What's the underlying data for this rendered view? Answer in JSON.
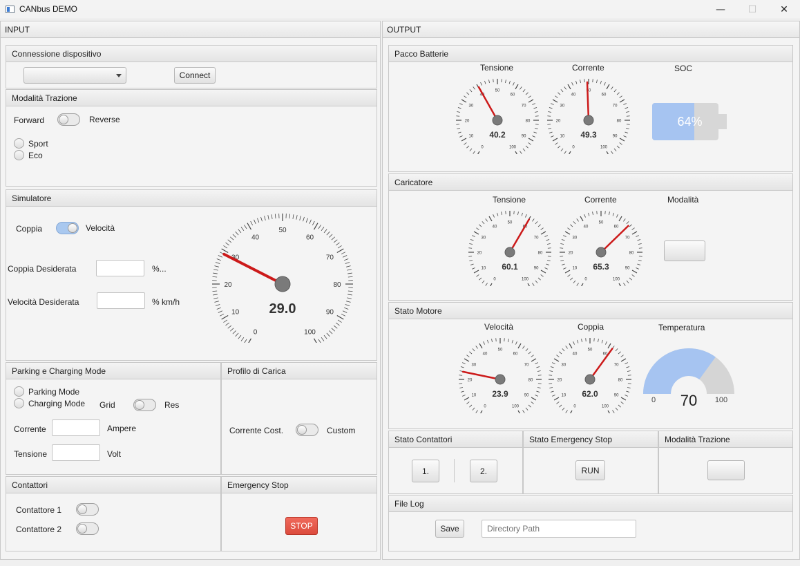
{
  "window": {
    "title": "CANbus DEMO",
    "minimize": "—",
    "maximize": "☐",
    "close": "✕"
  },
  "input": {
    "header": "INPUT",
    "connessione": {
      "title": "Connessione dispositivo",
      "connect_label": "Connect",
      "combo_value": ""
    },
    "modalita": {
      "title": "Modalità Trazione",
      "forward": "Forward",
      "reverse": "Reverse",
      "sport": "Sport",
      "eco": "Eco"
    },
    "simulatore": {
      "title": "Simulatore",
      "coppia": "Coppia",
      "velocita": "Velocità",
      "coppia_desiderata": "Coppia Desiderata",
      "coppia_unit": "%...",
      "velocita_desiderata": "Velocità Desiderata",
      "velocita_unit": "% km/h",
      "gauge": {
        "value": 29.0,
        "display": "29.0",
        "min": 0,
        "max": 100,
        "labels": [
          "0",
          "10",
          "20",
          "30",
          "40",
          "50",
          "60",
          "70",
          "80",
          "90",
          "100"
        ]
      }
    },
    "parking": {
      "title": "Parking e Charging Mode",
      "parking_mode": "Parking Mode",
      "charging_mode": "Charging Mode",
      "grid": "Grid",
      "res": "Res",
      "corrente": "Corrente",
      "ampere": "Ampere",
      "tensione": "Tensione",
      "volt": "Volt"
    },
    "profilo": {
      "title": "Profilo di Carica",
      "corrente_cost": "Corrente Cost.",
      "custom": "Custom"
    },
    "contattori": {
      "title": "Contattori",
      "c1": "Contattore 1",
      "c2": "Contattore 2"
    },
    "emergency": {
      "title": "Emergency Stop",
      "stop_label": "STOP"
    }
  },
  "output": {
    "header": "OUTPUT",
    "pacco": {
      "title": "Pacco Batterie",
      "tensione": {
        "label": "Tensione",
        "value": 40.2,
        "display": "40.2"
      },
      "corrente": {
        "label": "Corrente",
        "value": 49.3,
        "display": "49.3"
      },
      "soc": {
        "label": "SOC",
        "value": 64,
        "display": "64%"
      }
    },
    "caricatore": {
      "title": "Caricatore",
      "tensione": {
        "label": "Tensione",
        "value": 60.1,
        "display": "60.1"
      },
      "corrente": {
        "label": "Corrente",
        "value": 65.3,
        "display": "65.3"
      },
      "modalita": {
        "label": "Modalità",
        "button_label": ""
      }
    },
    "motore": {
      "title": "Stato Motore",
      "velocita": {
        "label": "Velocità",
        "value": 23.9,
        "display": "23.9"
      },
      "coppia": {
        "label": "Coppia",
        "value": 62.0,
        "display": "62.0"
      },
      "temperatura": {
        "label": "Temperatura",
        "value": 70,
        "display": "70",
        "min": "0",
        "max": "100"
      }
    },
    "contattori": {
      "title": "Stato Contattori",
      "b1": "1.",
      "b2": "2."
    },
    "emergency": {
      "title": "Stato Emergency Stop",
      "run_label": "RUN"
    },
    "modalita": {
      "title": "Modalità Trazione",
      "button_label": ""
    },
    "filelog": {
      "title": "File Log",
      "save_label": "Save",
      "path_placeholder": "Directory Path"
    },
    "small_gauge_labels": [
      "0",
      "10",
      "20",
      "30",
      "40",
      "50",
      "60",
      "70",
      "80",
      "90",
      "100"
    ]
  },
  "colors": {
    "needle": "#cc1a1a",
    "accent": "#a9c8ef",
    "stop": "#e0503f",
    "battery": "#a6c4f1",
    "temp_rest": "#d5d5d5"
  }
}
